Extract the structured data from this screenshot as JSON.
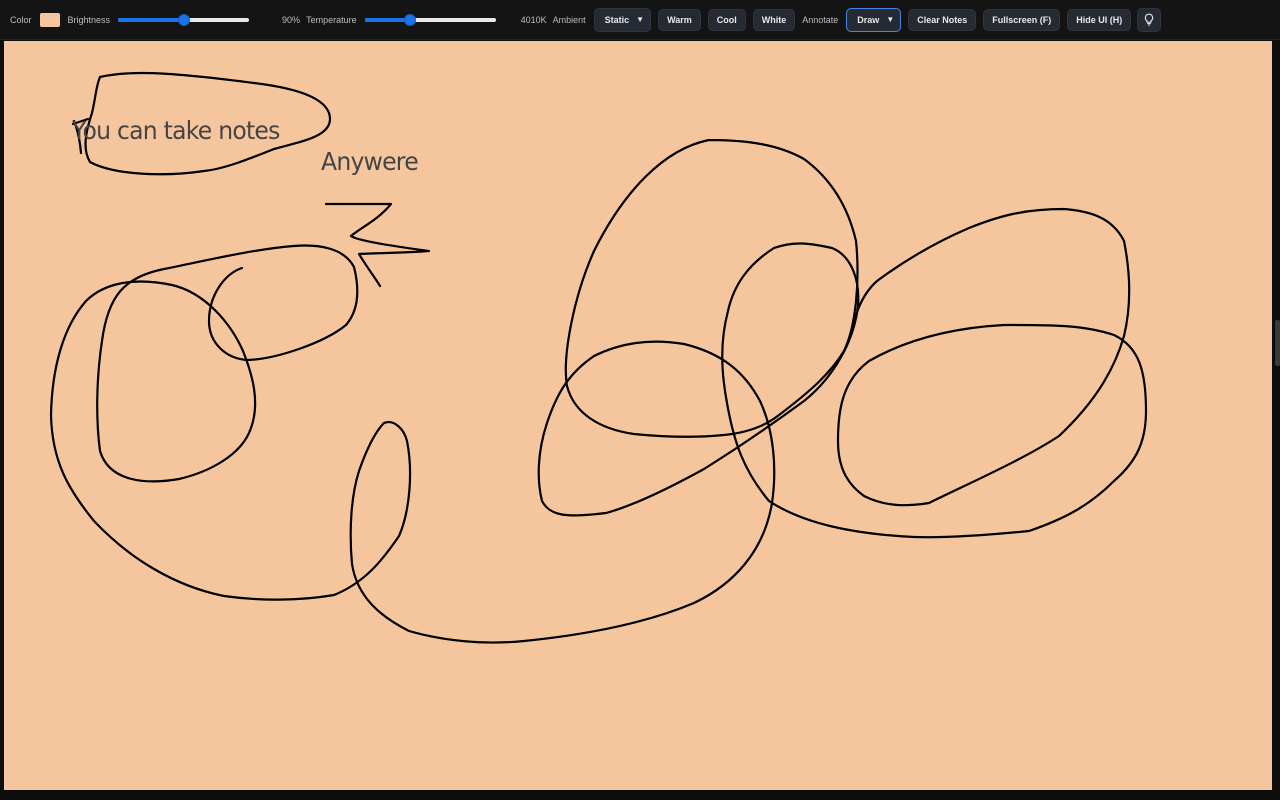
{
  "toolbar": {
    "color_label": "Color",
    "color_value": "#f5c69e",
    "brightness_label": "Brightness",
    "brightness_value": "90%",
    "brightness_fraction": 0.5,
    "temperature_label": "Temperature",
    "temperature_value": "4010K",
    "temperature_fraction": 0.35,
    "ambient_label": "Ambient",
    "ambient_selected": "Static",
    "warm_label": "Warm",
    "cool_label": "Cool",
    "white_label": "White",
    "annotate_label": "Annotate",
    "annotate_selected": "Draw",
    "clear_notes_label": "Clear Notes",
    "fullscreen_label": "Fullscreen (F)",
    "hide_ui_label": "Hide UI (H)",
    "light_icon": "lightbulb-icon",
    "accent_color": "#1a73e8"
  },
  "canvas": {
    "background_color": "#f5c69e",
    "ink_color": "#000000",
    "notes": [
      {
        "text": "You can take notes"
      },
      {
        "text": "Anywere"
      }
    ]
  }
}
